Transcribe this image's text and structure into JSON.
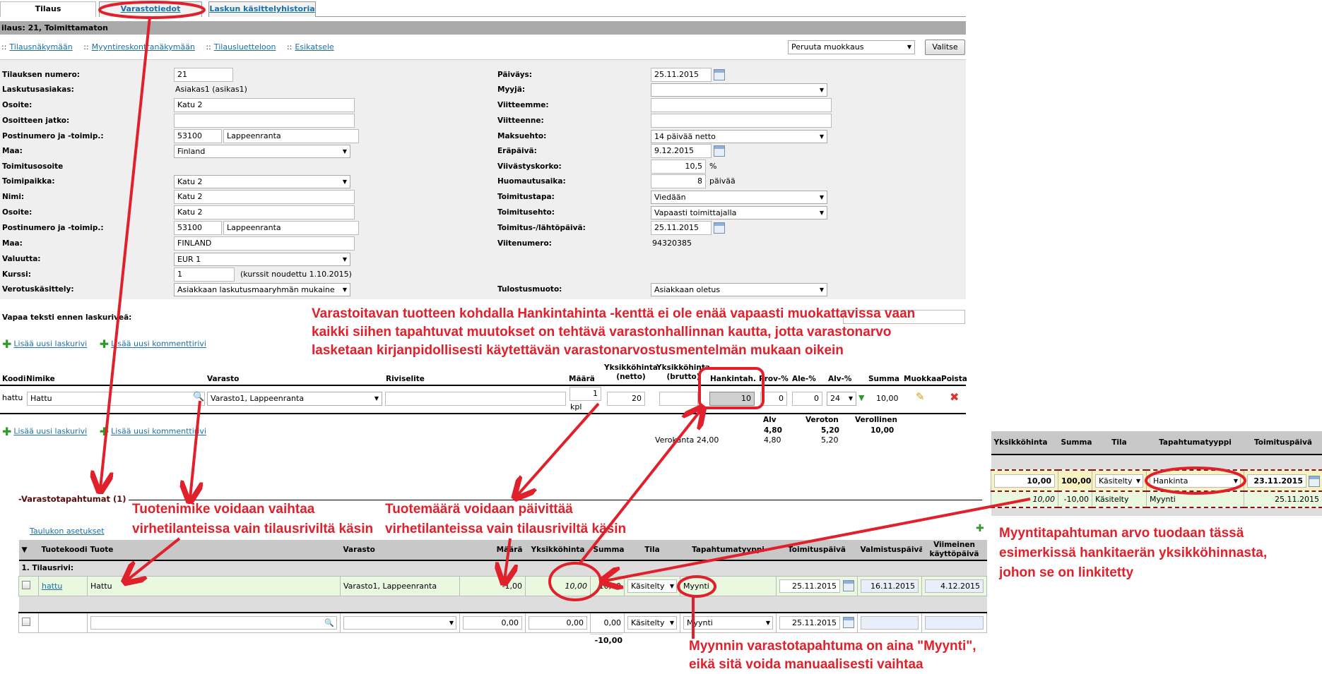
{
  "tabs": [
    {
      "label": "Tilaus"
    },
    {
      "label": "Varastotiedot"
    },
    {
      "label": "Laskun käsittelyhistoria"
    }
  ],
  "title": "ilaus: 21, Toimittamaton",
  "nav": {
    "sep": "::",
    "links": [
      "Tilausnäkymään",
      "Myyntireskontranäkymään",
      "Tilausluetteloon",
      "Esikatsele"
    ]
  },
  "action": {
    "select": "Peruuta muokkaus",
    "button": "Valitse"
  },
  "left": {
    "tilausnumero": {
      "label": "Tilauksen numero:",
      "value": "21"
    },
    "laskutusasiakas": {
      "label": "Laskutusasiakas:",
      "value": "Asiakas1 (asikas1)"
    },
    "osoite": {
      "label": "Osoite:",
      "value": "Katu 2"
    },
    "osoitejatko": {
      "label": "Osoitteen jatko:",
      "value": ""
    },
    "postinro": {
      "label": "Postinumero ja -toimip.:",
      "zip": "53100",
      "city": "Lappeenranta"
    },
    "maa": {
      "label": "Maa:",
      "value": "Finland"
    },
    "toimitusosoite": {
      "label": "Toimitusosoite"
    },
    "toimipaikka": {
      "label": "Toimipaikka:",
      "value": "Katu 2"
    },
    "nimi": {
      "label": "Nimi:",
      "value": "Katu 2"
    },
    "osoite2": {
      "label": "Osoite:",
      "value": "Katu 2"
    },
    "postinro2": {
      "label": "Postinumero ja -toimip.:",
      "zip": "53100",
      "city": "Lappeenranta"
    },
    "maa2": {
      "label": "Maa:",
      "value": "FINLAND"
    },
    "valuutta": {
      "label": "Valuutta:",
      "value": "EUR 1"
    },
    "kurssi": {
      "label": "Kurssi:",
      "value": "1",
      "note": "(kurssit noudettu 1.10.2015)"
    },
    "verotus": {
      "label": "Verotuskäsittely:",
      "value": "Asiakkaan laskutusmaaryhmän mukaine"
    }
  },
  "right": {
    "paivays": {
      "label": "Päiväys:",
      "value": "25.11.2015"
    },
    "myyja": {
      "label": "Myyjä:",
      "value": ""
    },
    "viitteemme": {
      "label": "Viitteemme:",
      "value": ""
    },
    "viitteenne": {
      "label": "Viitteenne:",
      "value": ""
    },
    "maksuehto": {
      "label": "Maksuehto:",
      "value": "14 päivää netto"
    },
    "erapaiva": {
      "label": "Eräpäivä:",
      "value": "9.12.2015"
    },
    "viivastyskorko": {
      "label": "Viivästyskorko:",
      "value": "10,5",
      "unit": "%"
    },
    "huomautusaika": {
      "label": "Huomautusaika:",
      "value": "8",
      "unit": "päivää"
    },
    "toimitustapa": {
      "label": "Toimitustapa:",
      "value": "Viedään"
    },
    "toimitusehto": {
      "label": "Toimitusehto:",
      "value": "Vapaasti toimittajalla"
    },
    "toimituspaiva": {
      "label": "Toimitus-/lähtöpäivä:",
      "value": "25.11.2015"
    },
    "viitenumero": {
      "label": "Viitenumero:",
      "value": "94320385"
    },
    "tulostusmuoto": {
      "label": "Tulostusmuoto:",
      "value": "Asiakkaan oletus"
    }
  },
  "freetext": {
    "label": "Vapaa teksti ennen laskuriveä:",
    "value": ""
  },
  "addlinks": {
    "row": "Lisää uusi laskurivi",
    "comment": "Lisää uusi kommenttirivi"
  },
  "lines": {
    "headers": {
      "koodi": "Koodi",
      "nimike": "Nimike",
      "varasto": "Varasto",
      "riviselite": "Riviselite",
      "maara": "Määrä",
      "netto1": "Yksikköhinta",
      "netto2": "(netto)",
      "brutto1": "Yksikköhinta",
      "brutto2": "(brutto)",
      "hankinta": "Hankintah.",
      "prov": "Prov-%",
      "ale": "Ale-%",
      "alv": "Alv-%",
      "summa": "Summa",
      "muokkaa": "Muokkaa",
      "poista": "Poista"
    },
    "row": {
      "koodi": "hattu",
      "nimike": "Hattu",
      "varasto": "Varasto1, Lappeenranta",
      "riviselite": "",
      "maara": "1",
      "yksikko": "kpl",
      "netto": "20",
      "brutto": "",
      "hankinta": "10",
      "prov": "0",
      "ale": "0",
      "alv": "24",
      "summa": "10,00"
    },
    "totals": {
      "h_alv": "Alv",
      "h_veroton": "Veroton",
      "h_verollinen": "Verollinen",
      "alv": "4,80",
      "veroton": "5,20",
      "verollinen": "10,00",
      "verokanta_label": "Verokanta 24,00",
      "vk_alv": "4,80",
      "vk_veroton": "5,20"
    }
  },
  "stock": {
    "section": "Varastotapahtumat (1)",
    "settings": "Taulukon asetukset",
    "headers": [
      "Tuotekoodi",
      "Tuote",
      "Varasto",
      "Määrä",
      "Yksikköhinta",
      "Summa",
      "Tila",
      "Tapahtumatyyppi",
      "Toimituspäivä",
      "Valmistuspäivä",
      "Viimeinen käyttöpäivä"
    ],
    "group": "1. Tilausrivi:",
    "row": {
      "koodi": "hattu",
      "tuote": "Hattu",
      "varasto": "Varasto1, Lappeenranta",
      "maara": "-1,00",
      "hinta": "10,00",
      "summa": "10,00",
      "tila": "Käsitelty",
      "tyyppi": "Myynti",
      "toimitus": "25.11.2015",
      "valmistus": "16.11.2015",
      "viimeinen": "4.12.2015"
    },
    "newrow": {
      "maara": "0,00",
      "hinta": "0,00",
      "summa": "0,00",
      "tila": "Käsitelty",
      "tyyppi": "Myynti",
      "toimitus": "25.11.2015"
    },
    "total": "-10,00"
  },
  "purchase": {
    "headers": [
      "Yksikköhinta",
      "Summa",
      "Tila",
      "Tapahtumatyyppi",
      "Toimituspäivä"
    ],
    "row1": {
      "hinta": "10,00",
      "summa": "100,00",
      "tila": "Käsitelty",
      "tyyppi": "Hankinta",
      "paiva": "23.11.2015"
    },
    "row2": {
      "hinta": "10,00",
      "summa": "-10,00",
      "tila": "Käsitelty",
      "tyyppi": "Myynti",
      "paiva": "25.11.2015"
    }
  },
  "notes": {
    "hankinta": [
      "Varastoitavan tuotteen kohdalla Hankintahinta -kenttä ei ole enää vapaasti muokattavissa vaan",
      "kaikki siihen tapahtuvat muutokset on tehtävä varastonhallinnan kautta, jotta varastonarvo",
      "lasketaan kirjanpidollisesti käytettävän varastonarvostusmentelmän mukaan oikein"
    ],
    "nimike": [
      "Tuotenimike voidaan vaihtaa",
      "virhetilanteissa vain tilausriviltä käsin"
    ],
    "maara": [
      "Tuotemäärä voidaan päivittää",
      "virhetilanteissa vain tilausriviltä käsin"
    ],
    "myyntiarvo": [
      "Myyntitapahtuman arvo tuodaan tässä",
      "esimerkissä hankitaerän yksikköhinnasta,",
      "johon se on linkitetty"
    ],
    "myynti": [
      "Myynnin varastotapahtuma on aina \"Myynti\",",
      "eikä sitä voida manuaalisesti vaihtaa"
    ]
  },
  "colors": {
    "annotation": "#e0202a",
    "header": "#aaaaaa",
    "rowGreen": "#eaf8e0",
    "rowYellow": "#f6f3c0"
  }
}
